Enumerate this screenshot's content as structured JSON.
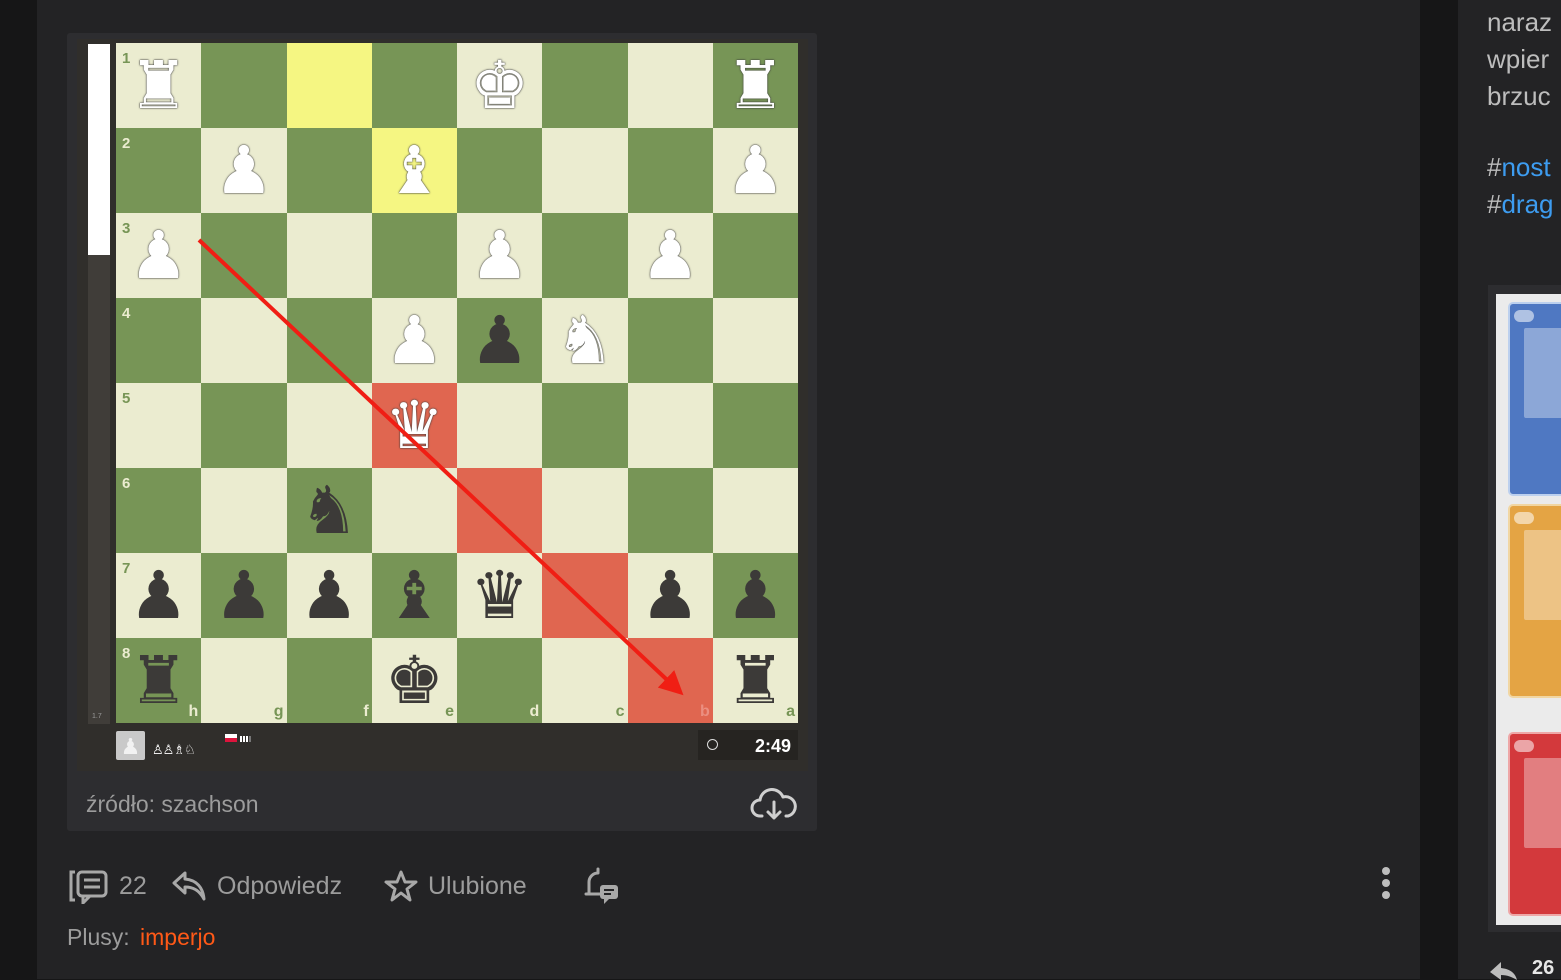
{
  "board": {
    "squares": [
      {
        "sq": "l",
        "rank": "1",
        "file": "",
        "piece": "♜",
        "color": "w"
      },
      {
        "sq": "d",
        "rank": "",
        "file": "",
        "piece": "",
        "color": ""
      },
      {
        "sq": "hly",
        "rank": "",
        "file": "",
        "piece": "",
        "color": ""
      },
      {
        "sq": "d",
        "rank": "",
        "file": "",
        "piece": "",
        "color": ""
      },
      {
        "sq": "l",
        "rank": "",
        "file": "",
        "piece": "♚",
        "color": "w"
      },
      {
        "sq": "d",
        "rank": "",
        "file": "",
        "piece": "",
        "color": ""
      },
      {
        "sq": "l",
        "rank": "",
        "file": "",
        "piece": "",
        "color": ""
      },
      {
        "sq": "d",
        "rank": "",
        "file": "",
        "piece": "♜",
        "color": "w"
      },
      {
        "sq": "d",
        "rank": "2",
        "file": "",
        "piece": "",
        "color": ""
      },
      {
        "sq": "l",
        "rank": "",
        "file": "",
        "piece": "♟",
        "color": "w"
      },
      {
        "sq": "d",
        "rank": "",
        "file": "",
        "piece": "",
        "color": ""
      },
      {
        "sq": "hly",
        "rank": "",
        "file": "",
        "piece": "♝",
        "color": "w"
      },
      {
        "sq": "d",
        "rank": "",
        "file": "",
        "piece": "",
        "color": ""
      },
      {
        "sq": "l",
        "rank": "",
        "file": "",
        "piece": "",
        "color": ""
      },
      {
        "sq": "d",
        "rank": "",
        "file": "",
        "piece": "",
        "color": ""
      },
      {
        "sq": "l",
        "rank": "",
        "file": "",
        "piece": "♟",
        "color": "w"
      },
      {
        "sq": "l",
        "rank": "3",
        "file": "",
        "piece": "♟",
        "color": "w"
      },
      {
        "sq": "d",
        "rank": "",
        "file": "",
        "piece": "",
        "color": ""
      },
      {
        "sq": "l",
        "rank": "",
        "file": "",
        "piece": "",
        "color": ""
      },
      {
        "sq": "d",
        "rank": "",
        "file": "",
        "piece": "",
        "color": ""
      },
      {
        "sq": "l",
        "rank": "",
        "file": "",
        "piece": "♟",
        "color": "w"
      },
      {
        "sq": "d",
        "rank": "",
        "file": "",
        "piece": "",
        "color": ""
      },
      {
        "sq": "l",
        "rank": "",
        "file": "",
        "piece": "♟",
        "color": "w"
      },
      {
        "sq": "d",
        "rank": "",
        "file": "",
        "piece": "",
        "color": ""
      },
      {
        "sq": "d",
        "rank": "4",
        "file": "",
        "piece": "",
        "color": ""
      },
      {
        "sq": "l",
        "rank": "",
        "file": "",
        "piece": "",
        "color": ""
      },
      {
        "sq": "d",
        "rank": "",
        "file": "",
        "piece": "",
        "color": ""
      },
      {
        "sq": "l",
        "rank": "",
        "file": "",
        "piece": "♟",
        "color": "w"
      },
      {
        "sq": "d",
        "rank": "",
        "file": "",
        "piece": "♟",
        "color": "b"
      },
      {
        "sq": "l",
        "rank": "",
        "file": "",
        "piece": "♞",
        "color": "w"
      },
      {
        "sq": "d",
        "rank": "",
        "file": "",
        "piece": "",
        "color": ""
      },
      {
        "sq": "l",
        "rank": "",
        "file": "",
        "piece": "",
        "color": ""
      },
      {
        "sq": "l",
        "rank": "5",
        "file": "",
        "piece": "",
        "color": ""
      },
      {
        "sq": "d",
        "rank": "",
        "file": "",
        "piece": "",
        "color": ""
      },
      {
        "sq": "l",
        "rank": "",
        "file": "",
        "piece": "",
        "color": ""
      },
      {
        "sq": "hlr",
        "rank": "",
        "file": "",
        "piece": "♛",
        "color": "w"
      },
      {
        "sq": "l",
        "rank": "",
        "file": "",
        "piece": "",
        "color": ""
      },
      {
        "sq": "d",
        "rank": "",
        "file": "",
        "piece": "",
        "color": ""
      },
      {
        "sq": "l",
        "rank": "",
        "file": "",
        "piece": "",
        "color": ""
      },
      {
        "sq": "d",
        "rank": "",
        "file": "",
        "piece": "",
        "color": ""
      },
      {
        "sq": "d",
        "rank": "6",
        "file": "",
        "piece": "",
        "color": ""
      },
      {
        "sq": "l",
        "rank": "",
        "file": "",
        "piece": "",
        "color": ""
      },
      {
        "sq": "d",
        "rank": "",
        "file": "",
        "piece": "♞",
        "color": "b"
      },
      {
        "sq": "l",
        "rank": "",
        "file": "",
        "piece": "",
        "color": ""
      },
      {
        "sq": "hlr",
        "rank": "",
        "file": "",
        "piece": "",
        "color": ""
      },
      {
        "sq": "l",
        "rank": "",
        "file": "",
        "piece": "",
        "color": ""
      },
      {
        "sq": "d",
        "rank": "",
        "file": "",
        "piece": "",
        "color": ""
      },
      {
        "sq": "l",
        "rank": "",
        "file": "",
        "piece": "",
        "color": ""
      },
      {
        "sq": "l",
        "rank": "7",
        "file": "",
        "piece": "♟",
        "color": "b"
      },
      {
        "sq": "d",
        "rank": "",
        "file": "",
        "piece": "♟",
        "color": "b"
      },
      {
        "sq": "l",
        "rank": "",
        "file": "",
        "piece": "♟",
        "color": "b"
      },
      {
        "sq": "d",
        "rank": "",
        "file": "",
        "piece": "♝",
        "color": "b"
      },
      {
        "sq": "l",
        "rank": "",
        "file": "",
        "piece": "♛",
        "color": "b"
      },
      {
        "sq": "hlr",
        "rank": "",
        "file": "",
        "piece": "",
        "color": ""
      },
      {
        "sq": "l",
        "rank": "",
        "file": "",
        "piece": "♟",
        "color": "b"
      },
      {
        "sq": "d",
        "rank": "",
        "file": "",
        "piece": "♟",
        "color": "b"
      },
      {
        "sq": "d",
        "rank": "8",
        "file": "h",
        "piece": "♜",
        "color": "b"
      },
      {
        "sq": "l",
        "rank": "",
        "file": "g",
        "piece": "",
        "color": ""
      },
      {
        "sq": "d",
        "rank": "",
        "file": "f",
        "piece": "",
        "color": ""
      },
      {
        "sq": "l",
        "rank": "",
        "file": "e",
        "piece": "♚",
        "color": "b"
      },
      {
        "sq": "d",
        "rank": "",
        "file": "d",
        "piece": "",
        "color": ""
      },
      {
        "sq": "l",
        "rank": "",
        "file": "c",
        "piece": "",
        "color": ""
      },
      {
        "sq": "hlr",
        "rank": "",
        "file": "b",
        "piece": "",
        "color": ""
      },
      {
        "sq": "l",
        "rank": "",
        "file": "a",
        "piece": "♜",
        "color": "b"
      }
    ],
    "arrow": {
      "from": "g3",
      "to": "b8",
      "color": "#f01e14"
    },
    "eval_label": "1.7",
    "eval_white_fraction": 0.31
  },
  "player": {
    "avatar_icon": "pawn-icon",
    "captured": "♙♙♗♘",
    "flag": "poland-flag-icon",
    "clock": "2:49"
  },
  "card": {
    "source": "źródło: szachson",
    "download_icon": "cloud-download-icon"
  },
  "actions": {
    "comments_count": "22",
    "reply": "Odpowiedz",
    "favorite": "Ulubione",
    "plusy_label": "Plusy:",
    "plusy_user": "imperjo"
  },
  "right": {
    "text_lines": [
      "naraz",
      "wpier",
      "brzuc"
    ],
    "tags": [
      {
        "hash": "#",
        "name": "nost"
      },
      {
        "hash": "#",
        "name": "drag"
      }
    ],
    "share_count": "26"
  },
  "colors": {
    "light_square": "#ebecd0",
    "dark_square": "#779556",
    "last_move": "#f5f682",
    "highlight": "#e06650",
    "accent_user": "#ff5917",
    "tag": "#3d9cf0"
  }
}
